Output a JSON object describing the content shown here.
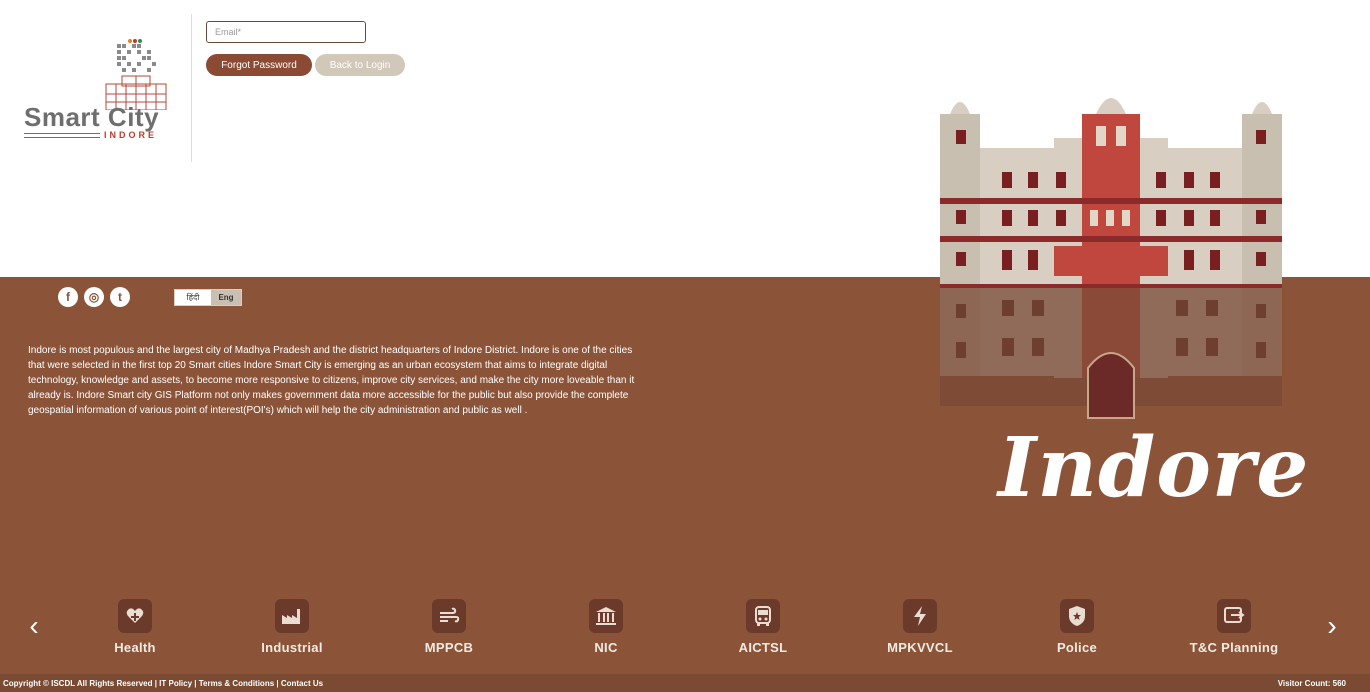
{
  "logo": {
    "word": "Smart City",
    "sub": "INDORE"
  },
  "login": {
    "email_placeholder": "Email*",
    "forgot_label": "Forgot Password",
    "back_label": "Back to Login"
  },
  "social": [
    {
      "icon": "facebook-icon",
      "glyph": "f"
    },
    {
      "icon": "instagram-icon",
      "glyph": "◎"
    },
    {
      "icon": "twitter-icon",
      "glyph": "t"
    }
  ],
  "language": {
    "hindi": "हिंदी",
    "english": "Eng"
  },
  "description": "Indore is most populous and the largest city of Madhya Pradesh and the district headquarters of Indore District. Indore is one of the cities that were selected in the first top 20 Smart cities Indore Smart City is emerging as an urban ecosystem that aims to integrate digital technology, knowledge and assets, to become more responsive to citizens, improve city services, and make the city more loveable than it already is. Indore Smart city GIS Platform not only makes government data more accessible for the public but also provide the complete geospatial information of various point of interest(POI's) which will help the city administration and public as well .",
  "city_title": "Indore",
  "carousel": {
    "prev_glyph": "‹",
    "next_glyph": "›",
    "items": [
      {
        "label": "Health",
        "icon": "health-icon"
      },
      {
        "label": "Industrial",
        "icon": "factory-icon"
      },
      {
        "label": "MPPCB",
        "icon": "wind-icon"
      },
      {
        "label": "NIC",
        "icon": "government-building-icon"
      },
      {
        "label": "AICTSL",
        "icon": "bus-icon"
      },
      {
        "label": "MPKVVCL",
        "icon": "lightning-icon"
      },
      {
        "label": "Police",
        "icon": "police-badge-icon"
      },
      {
        "label": "T&C Planning",
        "icon": "planning-icon"
      }
    ]
  },
  "footer": {
    "copyright": "Copyright © ISCDL All Rights Reserved | IT Policy | Terms & Conditions | Contact Us",
    "visitor": "Visitor Count: 560"
  },
  "colors": {
    "brown": "#8b5439",
    "button": "#8b4a33",
    "button_muted": "#d2c8b9",
    "accent_red": "#c0392b"
  }
}
